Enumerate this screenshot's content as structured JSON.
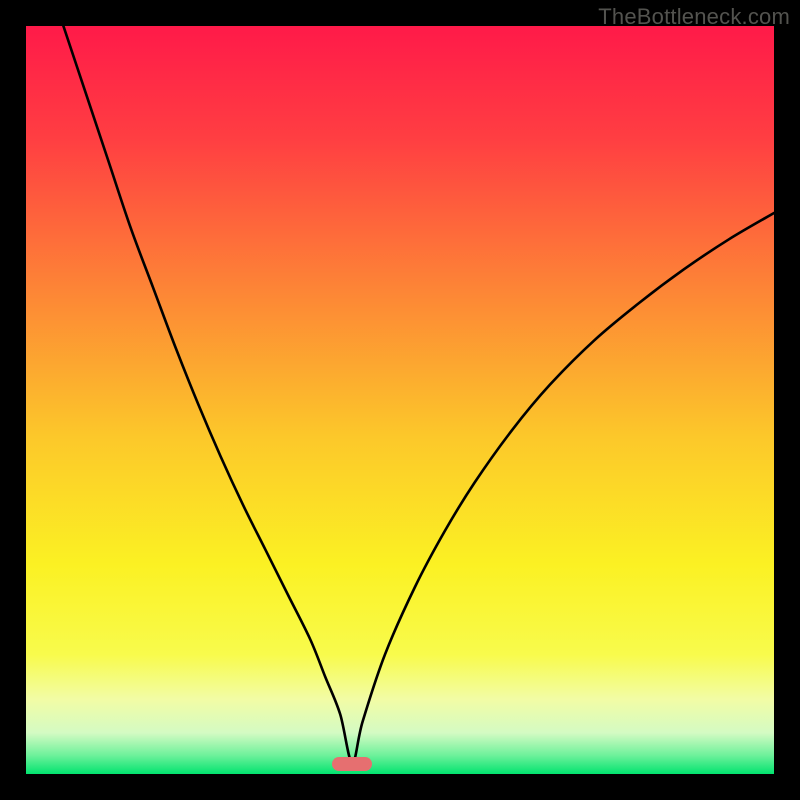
{
  "watermark": "TheBottleneck.com",
  "gradient_stops": [
    {
      "offset": 0.0,
      "color": "#ff1a49"
    },
    {
      "offset": 0.15,
      "color": "#ff3e42"
    },
    {
      "offset": 0.35,
      "color": "#fd8436"
    },
    {
      "offset": 0.55,
      "color": "#fcc82a"
    },
    {
      "offset": 0.72,
      "color": "#fbf123"
    },
    {
      "offset": 0.84,
      "color": "#f8fb4c"
    },
    {
      "offset": 0.9,
      "color": "#f2fca5"
    },
    {
      "offset": 0.945,
      "color": "#d4fbc3"
    },
    {
      "offset": 0.975,
      "color": "#6ef19b"
    },
    {
      "offset": 1.0,
      "color": "#02e36f"
    }
  ],
  "marker": {
    "x_frac": 0.436,
    "y_frac": 0.987,
    "color": "#e66f70"
  },
  "chart_data": {
    "type": "line",
    "title": "",
    "xlabel": "",
    "ylabel": "",
    "xlim": [
      0,
      100
    ],
    "ylim": [
      0,
      100
    ],
    "grid": false,
    "series": [
      {
        "name": "curve",
        "x": [
          5,
          8,
          11,
          14,
          17,
          20,
          23,
          26,
          29,
          32,
          35,
          38,
          40,
          42,
          43.6,
          45,
          48,
          52,
          56,
          60,
          65,
          70,
          76,
          82,
          88,
          94,
          100
        ],
        "y": [
          100,
          91,
          82,
          73,
          65,
          57,
          49.5,
          42.5,
          36,
          30,
          24,
          18,
          13,
          8,
          1.5,
          7,
          16,
          25,
          32.5,
          39,
          46,
          52,
          58,
          63,
          67.5,
          71.5,
          75
        ]
      }
    ],
    "marker_point": {
      "x": 43.6,
      "y": 1.3
    }
  }
}
